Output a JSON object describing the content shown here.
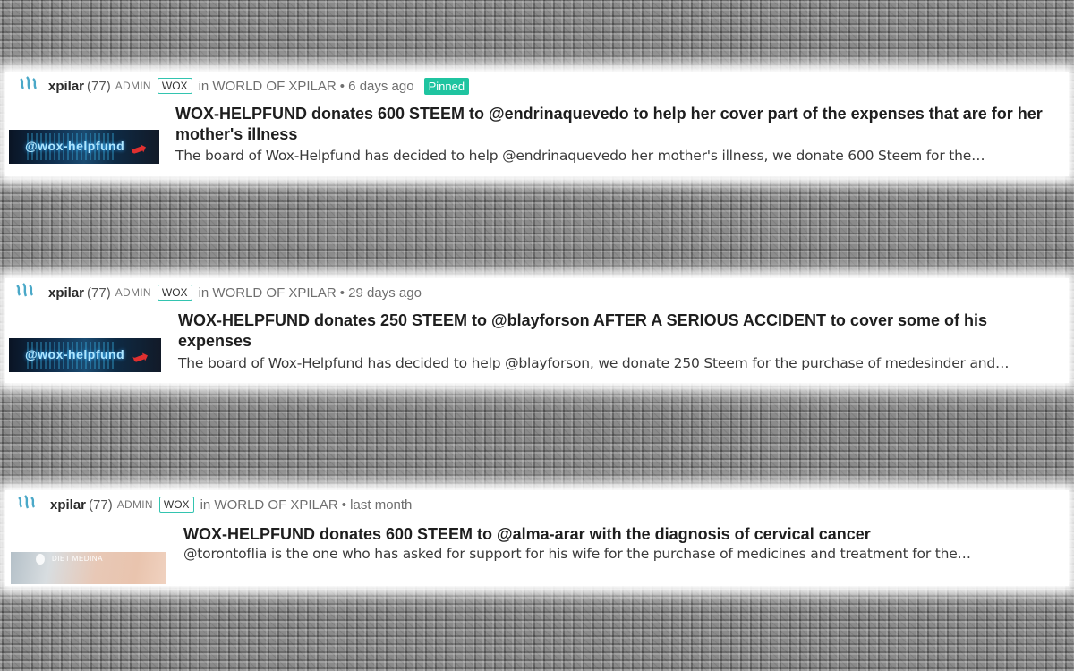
{
  "posts": [
    {
      "author": "xpilar",
      "reputation": "(77)",
      "role": "ADMIN",
      "tag": "WOX",
      "community": "in WORLD OF XPILAR",
      "time": "• 6 days ago",
      "pinned": "Pinned",
      "thumbnail_text": "@wox-helpfund",
      "title": "WOX-HELPFUND donates 600 STEEM to @endrinaquevedo to help her cover part of the expenses that are for her mother's illness",
      "summary": "The board of Wox-Helpfund has decided to help @endrinaquevedo her mother's illness, we donate 600 Steem for the…"
    },
    {
      "author": "xpilar",
      "reputation": "(77)",
      "role": "ADMIN",
      "tag": "WOX",
      "community": "in WORLD OF XPILAR",
      "time": "• 29 days ago",
      "thumbnail_text": "@wox-helpfund",
      "title": "WOX-HELPFUND donates 250 STEEM to @blayforson AFTER A SERIOUS ACCIDENT to cover some of his expenses",
      "summary": "The board of Wox-Helpfund has decided to help @blayforson, we donate 250 Steem for the purchase of medesinder and…"
    },
    {
      "author": "xpilar",
      "reputation": "(77)",
      "role": "ADMIN",
      "tag": "WOX",
      "community": "in WORLD OF XPILAR",
      "time": "• last month",
      "thumbnail_text": "DIET MEDINA",
      "title": "WOX-HELPFUND donates 600 STEEM to @alma-arar with the diagnosis of cervical cancer",
      "summary": "@torontoflia is the one who has asked for support for his wife for the purchase of medicines and treatment for the…"
    }
  ],
  "colors": {
    "pinned_badge": "#1fc4a0",
    "tag_border": "#33c4b0",
    "logo": "#4aa8c8"
  },
  "icons": {
    "community_logo": "steem-logo-icon",
    "thumbnail_arrow": "red-arrow-icon"
  }
}
